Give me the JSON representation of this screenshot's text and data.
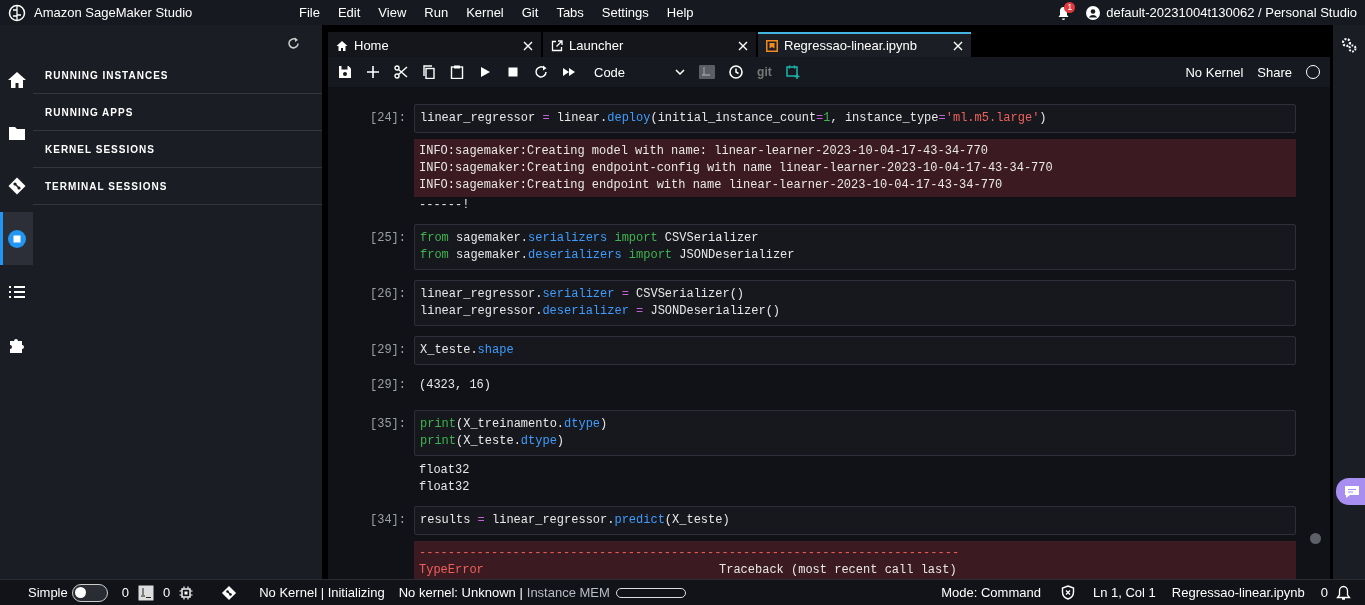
{
  "top_bar": {
    "title": "Amazon SageMaker Studio",
    "menu": [
      "File",
      "Edit",
      "View",
      "Run",
      "Kernel",
      "Git",
      "Tabs",
      "Settings",
      "Help"
    ],
    "notification_count": "1",
    "user": "default-20231004t130062 / Personal Studio"
  },
  "activity_bar": [
    {
      "kind": "home",
      "selected": false
    },
    {
      "kind": "folder",
      "selected": false
    },
    {
      "kind": "git",
      "selected": false
    },
    {
      "kind": "sessions",
      "selected": true
    },
    {
      "kind": "list",
      "selected": false
    },
    {
      "kind": "extensions",
      "selected": false
    }
  ],
  "sidebar": {
    "sections": [
      "RUNNING INSTANCES",
      "RUNNING APPS",
      "KERNEL SESSIONS",
      "TERMINAL SESSIONS"
    ]
  },
  "tabs": [
    {
      "label": "Home",
      "kind": "home",
      "selected": false
    },
    {
      "label": "Launcher",
      "kind": "launcher",
      "selected": false
    },
    {
      "label": "Regressao-linear.ipynb",
      "kind": "notebook",
      "selected": true
    }
  ],
  "toolbar": {
    "cell_type": "Code",
    "git": "git",
    "kernel": "No Kernel",
    "share": "Share"
  },
  "cells": [
    {
      "prompt": "[24]:",
      "code": [
        [
          {
            "text": "linear_regressor ",
            "kind": "plain"
          },
          {
            "text": "=",
            "kind": "op"
          },
          {
            "text": " linear.",
            "kind": "plain"
          },
          {
            "text": "deploy",
            "kind": "attr"
          },
          {
            "text": "(initial_instance_count",
            "kind": "plain"
          },
          {
            "text": "=",
            "kind": "op"
          },
          {
            "text": "1",
            "kind": "num"
          },
          {
            "text": ", instance_type",
            "kind": "plain"
          },
          {
            "text": "=",
            "kind": "op"
          },
          {
            "text": "'ml.m5.large'",
            "kind": "str"
          },
          {
            "text": ")",
            "kind": "plain"
          }
        ]
      ],
      "outputs": [
        {
          "kind": "stderr",
          "lines": [
            "INFO:sagemaker:Creating model with name: linear-learner-2023-10-04-17-43-34-770",
            "INFO:sagemaker:Creating endpoint-config with name linear-learner-2023-10-04-17-43-34-770",
            "INFO:sagemaker:Creating endpoint with name linear-learner-2023-10-04-17-43-34-770"
          ]
        },
        {
          "kind": "stream",
          "lines": [
            "------!"
          ]
        }
      ]
    },
    {
      "prompt": "[25]:",
      "code": [
        [
          {
            "text": "from",
            "kind": "kw"
          },
          {
            "text": " sagemaker.",
            "kind": "plain"
          },
          {
            "text": "serializers",
            "kind": "attr"
          },
          {
            "text": " import",
            "kind": "kw"
          },
          {
            "text": " CSVSerializer",
            "kind": "plain"
          }
        ],
        [
          {
            "text": "from",
            "kind": "kw"
          },
          {
            "text": " sagemaker.",
            "kind": "plain"
          },
          {
            "text": "deserializers",
            "kind": "attr"
          },
          {
            "text": " import",
            "kind": "kw"
          },
          {
            "text": " JSONDeserializer",
            "kind": "plain"
          }
        ]
      ]
    },
    {
      "prompt": "[26]:",
      "code": [
        [
          {
            "text": "linear_regressor.",
            "kind": "plain"
          },
          {
            "text": "serializer",
            "kind": "attr"
          },
          {
            "text": " =",
            "kind": "op"
          },
          {
            "text": " CSVSerializer()",
            "kind": "plain"
          }
        ],
        [
          {
            "text": "linear_regressor.",
            "kind": "plain"
          },
          {
            "text": "deserializer",
            "kind": "attr"
          },
          {
            "text": " =",
            "kind": "op"
          },
          {
            "text": " JSONDeserializer()",
            "kind": "plain"
          }
        ]
      ]
    },
    {
      "prompt": "[29]:",
      "code": [
        [
          {
            "text": "X_teste.",
            "kind": "plain"
          },
          {
            "text": "shape",
            "kind": "attr"
          }
        ]
      ],
      "outputs": [
        {
          "kind": "result",
          "prompt": "[29]:",
          "lines": [
            "(4323, 16)"
          ]
        }
      ]
    },
    {
      "prompt": "[35]:",
      "code": [
        [
          {
            "text": "print",
            "kind": "kw"
          },
          {
            "text": "(X_treinamento.",
            "kind": "plain"
          },
          {
            "text": "dtype",
            "kind": "attr"
          },
          {
            "text": ")",
            "kind": "plain"
          }
        ],
        [
          {
            "text": "print",
            "kind": "kw"
          },
          {
            "text": "(X_teste.",
            "kind": "plain"
          },
          {
            "text": "dtype",
            "kind": "attr"
          },
          {
            "text": ")",
            "kind": "plain"
          }
        ]
      ],
      "outputs": [
        {
          "kind": "stream",
          "lines": [
            "float32",
            "float32"
          ]
        }
      ]
    },
    {
      "prompt": "[34]:",
      "code": [
        [
          {
            "text": "results ",
            "kind": "plain"
          },
          {
            "text": "=",
            "kind": "op"
          },
          {
            "text": " linear_regressor.",
            "kind": "plain"
          },
          {
            "text": "predict",
            "kind": "attr"
          },
          {
            "text": "(X_teste)",
            "kind": "plain"
          }
        ]
      ],
      "outputs": [
        {
          "kind": "error",
          "rule": "---------------------------------------------------------------------------",
          "name": "TypeError",
          "message": "Traceback (most recent call last)"
        }
      ]
    }
  ],
  "status_bar": {
    "simple": {
      "label": "Simple",
      "on": false
    },
    "terminals": "0",
    "kernels": "0",
    "kernel_status": "No Kernel | Initializing",
    "kernel_info": "No kernel: Unknown |",
    "memory": {
      "label": "Instance MEM"
    },
    "mode": "Mode: Command",
    "position": "Ln 1, Col 1",
    "file": "Regressao-linear.ipynb",
    "notifications": "0"
  }
}
